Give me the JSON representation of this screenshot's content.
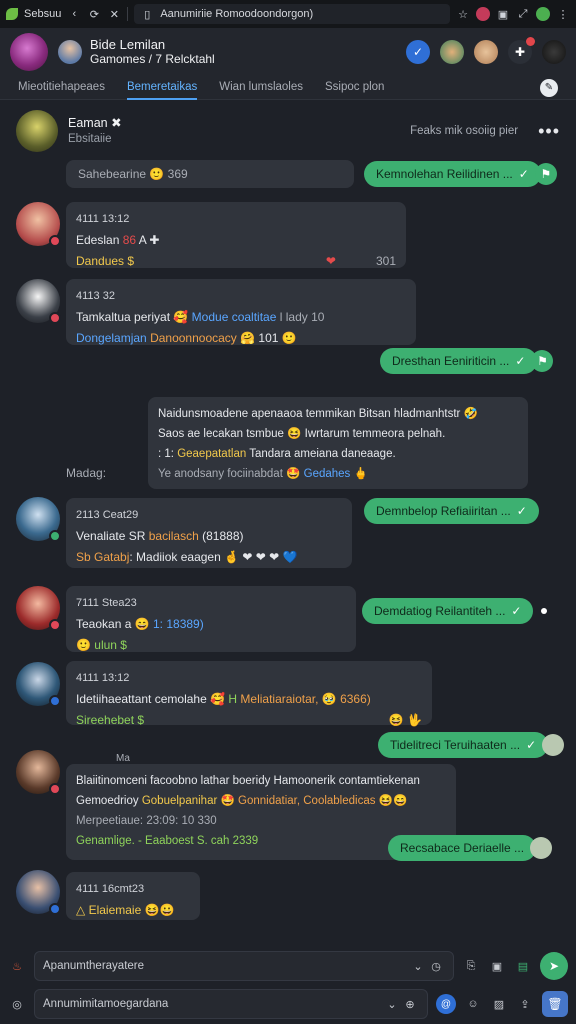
{
  "browser": {
    "app_title": "Sebsuu",
    "url": "Aanumiriie Romoodoondorgon)"
  },
  "header": {
    "title": "Bide Lemilan",
    "subtitle": "Gamomes / 7 Relcktahl"
  },
  "tabs": [
    {
      "label": "Mieotitiehapeaes"
    },
    {
      "label": "Bemeretaikas"
    },
    {
      "label": "Wian lumslaoles"
    },
    {
      "label": "Ssipoc plon"
    }
  ],
  "chat": {
    "name": "Eaman ✖",
    "sub": "Ebsitaiie",
    "status": "Feaks mik osoiig pier"
  },
  "messages": {
    "out1": "Kemnolehan Reilidinen ...",
    "sys1": "Sahebearine 🙂 369",
    "m1": {
      "time": "4111 13:12",
      "text": "Edeslan",
      "text_red": "86",
      "text_tail": "A ✚",
      "meta": "Dandues $",
      "heart": "❤",
      "right": "301"
    },
    "m2": {
      "time": "4113 32",
      "text": "Tamkaltua periyat 🥰",
      "blue": "Modue coaltitae",
      "gray": "l lady 10",
      "meta_blue": "Dongelamjan",
      "meta_orange": "Danoonnoocacy",
      "meta_end": "🤗 101 🙂"
    },
    "out2": "Dresthan Eeniriticin ...",
    "m3": {
      "line1": "Naidunsmoadene apenaaoa temmikan Bitsan hladmanhtstr 🤣",
      "line2": "Saos ae lecakan tsmbue 😆 Iwrtarum temmeora pelnah.",
      "line3_prefix": ": 1: ",
      "line3_yellow": "Geaepatatlan",
      "line3_rest": " Tandara ameiana daneaage.",
      "line4": "Ye anodsany fociinabdat 🤩",
      "line4_blue": "Gedahes",
      "line4_end": "🖕",
      "side": "Madag:"
    },
    "out3": "Demnbelop Refiaiiritan ...",
    "m4": {
      "time": "2113 Ceat29",
      "text": "Venaliate",
      "text_mid": "SR",
      "orange": "bacilasch",
      "tail": "(81888)",
      "line2_orange": "Sb Gatabj",
      "line2": ": Madiiok eaagen 🤞 ❤ ❤ ❤ 💙"
    },
    "out4": "Demdatiog Reilantiteh ...",
    "m5": {
      "time": "7111 Stea23",
      "text": "Teaokan a",
      "blue": "😄 1: 18389)",
      "meta": "🙂 ulun $"
    },
    "m6": {
      "time": "4111 13:12",
      "text": "Idetiihaeattant cemolahe 🥰",
      "green": "H",
      "orange": "Meliatiaraiotar,",
      "tail": "🥹 6366)",
      "meta": "Sireehebet $",
      "end": "😆 🖖"
    },
    "out5": "Tidelitreci Teruihaaten ...",
    "m7": {
      "label": "Ma",
      "line1": "Blaiitinomceni facoobno lathar boeridy Hamoonerik contamtiekenan",
      "line2": "Gemoedrioy",
      "line2_yellow": "Gobuelpanihar",
      "line2_mid": "🤩",
      "line2_orange": "Gonnidatiar, Coolabledicas",
      "line2_end": "😆😄",
      "line3": "Merpeetiaue: 23:09: 10 330",
      "line4": "Genamlige. - Eaaboest S. cah 2339"
    },
    "out6": "Recsabace Deriaelle ...",
    "m8": {
      "time": "4111 16cmt23",
      "text": "△ Elaiemaie 😆😀"
    }
  },
  "composer1": {
    "placeholder": "Apanumtherayatere"
  },
  "composer2": {
    "placeholder": "Annumimitamoegardana"
  },
  "colors": {
    "accent": "#4ea0f2",
    "outgoing": "#3db071",
    "incoming": "#30343c",
    "background": "#1e2128"
  }
}
